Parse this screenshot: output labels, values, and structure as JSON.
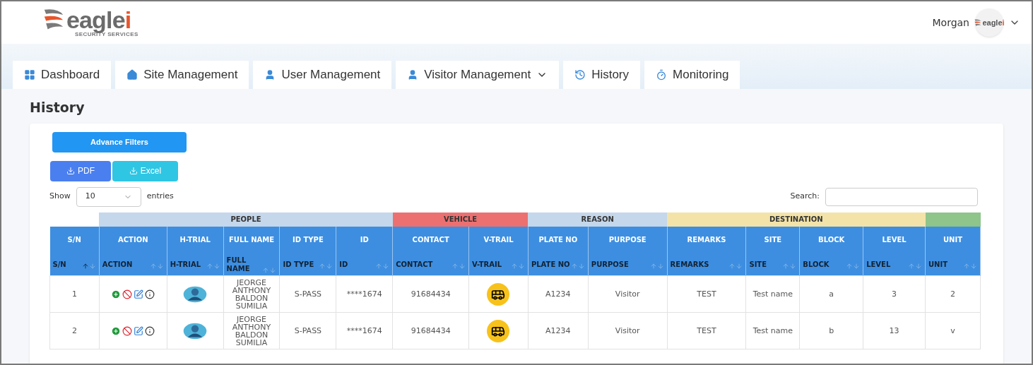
{
  "brand": {
    "name": "eagle",
    "accent": "i",
    "tagline": "SECURITY SERVICES"
  },
  "user": {
    "name": "Morgan",
    "avatar_logo": {
      "name": "eagle",
      "accent": "i"
    }
  },
  "tabs": [
    {
      "label": "Dashboard",
      "dropdown": false
    },
    {
      "label": "Site Management",
      "dropdown": false
    },
    {
      "label": "User Management",
      "dropdown": false
    },
    {
      "label": "Visitor Management",
      "dropdown": true
    },
    {
      "label": "History",
      "dropdown": false
    },
    {
      "label": "Monitoring",
      "dropdown": false
    }
  ],
  "page_title": "History",
  "filters_button": "Advance Filters",
  "export_buttons": [
    {
      "label": "PDF",
      "kind": "pdf"
    },
    {
      "label": "Excel",
      "kind": "excel"
    }
  ],
  "length": {
    "prefix": "Show",
    "value": "10",
    "suffix": "entries"
  },
  "search": {
    "label": "Search:"
  },
  "table": {
    "groups": [
      {
        "label": "PEOPLE",
        "color": "#c5d7ea"
      },
      {
        "label": "VEHICLE",
        "color": "#ec7070"
      },
      {
        "label": "REASON",
        "color": "#c5d7ea"
      },
      {
        "label": "DESTINATION",
        "color": "#f3e3a8"
      },
      {
        "color": "#8fc48a"
      }
    ],
    "columns": [
      {
        "title": "S/N",
        "filter": "S/N",
        "sorted": true
      },
      {
        "title": "ACTION",
        "filter": "ACTION",
        "sorted": false
      },
      {
        "title": "H-TRIAL",
        "filter": "H-TRIAL",
        "sorted": false
      },
      {
        "title": "FULL NAME",
        "filter": "FULL NAME",
        "sorted": false
      },
      {
        "title": "ID TYPE",
        "filter": "ID TYPE",
        "sorted": false
      },
      {
        "title": "ID",
        "filter": "ID",
        "sorted": false
      },
      {
        "title": "CONTACT",
        "filter": "CONTACT",
        "sorted": false
      },
      {
        "title": "V-TRAIL",
        "filter": "V-TRAIL",
        "sorted": false
      },
      {
        "title": "PLATE NO",
        "filter": "PLATE NO",
        "sorted": false
      },
      {
        "title": "PURPOSE",
        "filter": "PURPOSE",
        "sorted": false
      },
      {
        "title": "REMARKS",
        "filter": "REMARKS",
        "sorted": false
      },
      {
        "title": "SITE",
        "filter": "SITE",
        "sorted": false
      },
      {
        "title": "BLOCK",
        "filter": "BLOCK",
        "sorted": false
      },
      {
        "title": "LEVEL",
        "filter": "LEVEL",
        "sorted": false
      },
      {
        "title": "UNIT",
        "filter": "UNIT",
        "sorted": false
      }
    ],
    "rows": [
      {
        "cells": [
          {
            "kind": "text",
            "text": "1"
          },
          {
            "kind": "actions"
          },
          {
            "kind": "avatar"
          },
          {
            "kind": "text",
            "text": "JEORGE ANTHONY BALDON SUMILIA"
          },
          {
            "kind": "text",
            "text": "S-PASS"
          },
          {
            "kind": "text",
            "text": "****1674"
          },
          {
            "kind": "text",
            "text": "91684434"
          },
          {
            "kind": "bus"
          },
          {
            "kind": "text",
            "text": "A1234"
          },
          {
            "kind": "text",
            "text": "Visitor"
          },
          {
            "kind": "text",
            "text": "TEST"
          },
          {
            "kind": "text",
            "text": "Test name"
          },
          {
            "kind": "text",
            "text": "a"
          },
          {
            "kind": "text",
            "text": "3"
          },
          {
            "kind": "text",
            "text": "2"
          }
        ]
      },
      {
        "cells": [
          {
            "kind": "text",
            "text": "2"
          },
          {
            "kind": "actions"
          },
          {
            "kind": "avatar"
          },
          {
            "kind": "text",
            "text": "JEORGE ANTHONY BALDON SUMILIA"
          },
          {
            "kind": "text",
            "text": "S-PASS"
          },
          {
            "kind": "text",
            "text": "****1674"
          },
          {
            "kind": "text",
            "text": "91684434"
          },
          {
            "kind": "bus"
          },
          {
            "kind": "text",
            "text": "A1234"
          },
          {
            "kind": "text",
            "text": "Visitor"
          },
          {
            "kind": "text",
            "text": "TEST"
          },
          {
            "kind": "text",
            "text": "Test name"
          },
          {
            "kind": "text",
            "text": "b"
          },
          {
            "kind": "text",
            "text": "13"
          },
          {
            "kind": "text",
            "text": "v"
          }
        ]
      }
    ]
  }
}
